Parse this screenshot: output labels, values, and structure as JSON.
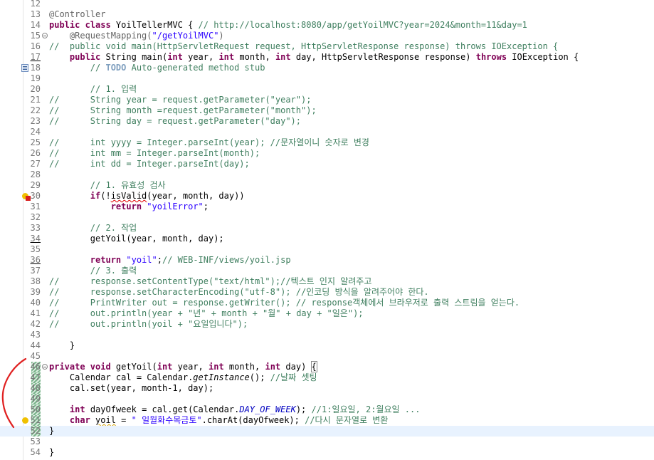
{
  "editor": {
    "lines": [
      {
        "n": "12",
        "segs": []
      },
      {
        "n": "13",
        "segs": [
          {
            "t": "@Controller",
            "c": "ann"
          }
        ]
      },
      {
        "n": "14",
        "segs": [
          {
            "t": "public class",
            "c": "kw"
          },
          {
            "t": " YoilTellerMVC { "
          },
          {
            "t": "// http://localhost:8080/app/getYoilMVC?year=2024&month=11&day=1",
            "c": "cm"
          }
        ]
      },
      {
        "n": "15",
        "fold": true,
        "segs": [
          {
            "t": "    "
          },
          {
            "t": "@RequestMapping(",
            "c": "ann"
          },
          {
            "t": "\"/getYoilMVC\"",
            "c": "str"
          },
          {
            "t": ")",
            "c": "ann"
          }
        ]
      },
      {
        "n": "16",
        "segs": [
          {
            "t": "//  public void main(HttpServletRequest request, HttpServletResponse response) throws IOException {",
            "c": "cm"
          }
        ]
      },
      {
        "n": "17",
        "ul": true,
        "segs": [
          {
            "t": "    "
          },
          {
            "t": "public",
            "c": "kw"
          },
          {
            "t": " String main("
          },
          {
            "t": "int",
            "c": "kw"
          },
          {
            "t": " year, "
          },
          {
            "t": "int",
            "c": "kw"
          },
          {
            "t": " month, "
          },
          {
            "t": "int",
            "c": "kw"
          },
          {
            "t": " day, HttpServletResponse response) "
          },
          {
            "t": "throws",
            "c": "kw"
          },
          {
            "t": " IOException {"
          }
        ]
      },
      {
        "n": "18",
        "marker": "task",
        "segs": [
          {
            "t": "        "
          },
          {
            "t": "// ",
            "c": "cm"
          },
          {
            "t": "TODO",
            "c": "todo"
          },
          {
            "t": " Auto-generated method stub",
            "c": "cm"
          }
        ]
      },
      {
        "n": "19",
        "segs": []
      },
      {
        "n": "20",
        "segs": [
          {
            "t": "        "
          },
          {
            "t": "// 1. 입력",
            "c": "cm"
          }
        ]
      },
      {
        "n": "21",
        "segs": [
          {
            "t": "//      String year = request.getParameter(\"year\");",
            "c": "cm"
          }
        ]
      },
      {
        "n": "22",
        "segs": [
          {
            "t": "//      String month =request.getParameter(\"month\");",
            "c": "cm"
          }
        ]
      },
      {
        "n": "23",
        "segs": [
          {
            "t": "//      String day = request.getParameter(\"day\");",
            "c": "cm"
          }
        ]
      },
      {
        "n": "24",
        "segs": []
      },
      {
        "n": "25",
        "segs": [
          {
            "t": "//      int yyyy = Integer.parseInt(year); //문자열이니 숫자로 변경",
            "c": "cm"
          }
        ]
      },
      {
        "n": "26",
        "segs": [
          {
            "t": "//      int mm = Integer.parseInt(month);",
            "c": "cm"
          }
        ]
      },
      {
        "n": "27",
        "segs": [
          {
            "t": "//      int dd = Integer.parseInt(day);",
            "c": "cm"
          }
        ]
      },
      {
        "n": "28",
        "segs": []
      },
      {
        "n": "29",
        "segs": [
          {
            "t": "        "
          },
          {
            "t": "// 1. 유효성 검사",
            "c": "cm"
          }
        ]
      },
      {
        "n": "30",
        "marker": "error",
        "segs": [
          {
            "t": "        "
          },
          {
            "t": "if",
            "c": "kw"
          },
          {
            "t": "(!"
          },
          {
            "t": "isValid",
            "c": "err"
          },
          {
            "t": "(year, month, day))"
          }
        ]
      },
      {
        "n": "31",
        "segs": [
          {
            "t": "            "
          },
          {
            "t": "return",
            "c": "kw"
          },
          {
            "t": " "
          },
          {
            "t": "\"yoilError\"",
            "c": "str"
          },
          {
            "t": ";"
          }
        ]
      },
      {
        "n": "32",
        "segs": []
      },
      {
        "n": "33",
        "segs": [
          {
            "t": "        "
          },
          {
            "t": "// 2. 작업",
            "c": "cm"
          }
        ]
      },
      {
        "n": "34",
        "ul": true,
        "segs": [
          {
            "t": "        getYoil(year, month, day);"
          }
        ]
      },
      {
        "n": "35",
        "segs": []
      },
      {
        "n": "36",
        "ul": true,
        "segs": [
          {
            "t": "        "
          },
          {
            "t": "return",
            "c": "kw"
          },
          {
            "t": " "
          },
          {
            "t": "\"yoil\"",
            "c": "str"
          },
          {
            "t": ";"
          },
          {
            "t": "// WEB-INF/views/yoil.jsp",
            "c": "cm"
          }
        ]
      },
      {
        "n": "37",
        "segs": [
          {
            "t": "        "
          },
          {
            "t": "// 3. 출력",
            "c": "cm"
          }
        ]
      },
      {
        "n": "38",
        "segs": [
          {
            "t": "//      response.setContentType(\"text/html\");//텍스트 인지 알려주고",
            "c": "cm"
          }
        ]
      },
      {
        "n": "39",
        "segs": [
          {
            "t": "//      response.setCharacterEncoding(\"utf-8\"); //인코딩 방식을 알려주어야 한다.",
            "c": "cm"
          }
        ]
      },
      {
        "n": "40",
        "segs": [
          {
            "t": "//      PrintWriter out = response.getWriter(); // response객체에서 브라우저로 출력 스트림을 얻는다.",
            "c": "cm"
          }
        ]
      },
      {
        "n": "41",
        "segs": [
          {
            "t": "//      out.println(year + \"년\" + month + \"월\" + day + \"일은\");",
            "c": "cm"
          }
        ]
      },
      {
        "n": "42",
        "segs": [
          {
            "t": "//      out.println(yoil + \"요일입니다\");",
            "c": "cm"
          }
        ]
      },
      {
        "n": "43",
        "segs": []
      },
      {
        "n": "44",
        "segs": [
          {
            "t": "    }"
          }
        ]
      },
      {
        "n": "45",
        "segs": []
      },
      {
        "n": "46",
        "fold": true,
        "change": true,
        "segs": [
          {
            "t": "private void",
            "c": "kw"
          },
          {
            "t": " getYoil("
          },
          {
            "t": "int",
            "c": "kw"
          },
          {
            "t": " year, "
          },
          {
            "t": "int",
            "c": "kw"
          },
          {
            "t": " month, "
          },
          {
            "t": "int",
            "c": "kw"
          },
          {
            "t": " day) "
          },
          {
            "t": "{",
            "c": "br"
          }
        ]
      },
      {
        "n": "47",
        "change": true,
        "segs": [
          {
            "t": "    Calendar cal = Calendar."
          },
          {
            "t": "getInstance",
            "c": "it"
          },
          {
            "t": "(); "
          },
          {
            "t": "//날짜 셋팅",
            "c": "cm"
          }
        ]
      },
      {
        "n": "48",
        "change": true,
        "segs": [
          {
            "t": "    cal.set(year, month-1, day);"
          }
        ]
      },
      {
        "n": "49",
        "change": true,
        "segs": []
      },
      {
        "n": "50",
        "change": true,
        "segs": [
          {
            "t": "    "
          },
          {
            "t": "int",
            "c": "kw"
          },
          {
            "t": " dayOfweek = cal.get(Calendar."
          },
          {
            "t": "DAY_OF_WEEK",
            "c": "static"
          },
          {
            "t": "); "
          },
          {
            "t": "//1:일요일, 2:월요일 ...",
            "c": "cm"
          }
        ]
      },
      {
        "n": "51",
        "marker": "warn",
        "change": true,
        "segs": [
          {
            "t": "    "
          },
          {
            "t": "char",
            "c": "kw"
          },
          {
            "t": " "
          },
          {
            "t": "yoil",
            "c": "warn"
          },
          {
            "t": " = "
          },
          {
            "t": "\" 일월화수목금토\"",
            "c": "str"
          },
          {
            "t": ".charAt(dayOfweek); "
          },
          {
            "t": "//다시 문자열로 변환",
            "c": "cm"
          }
        ]
      },
      {
        "n": "52",
        "change": true,
        "hl": true,
        "segs": [
          {
            "t": "}"
          }
        ]
      },
      {
        "n": "53",
        "segs": []
      },
      {
        "n": "54",
        "segs": [
          {
            "t": "}"
          }
        ]
      }
    ]
  },
  "icons": {
    "task_marker": "task-icon",
    "error_marker": "error-icon",
    "warning_marker": "warning-icon",
    "fold_toggle": "collapse-icon"
  },
  "colors": {
    "keyword": "#7f0055",
    "string": "#2a00ff",
    "comment": "#3f7f5f",
    "annotation": "#646464",
    "static_field": "#0000c0",
    "current_line": "#e8f2fe",
    "annotation_ink": "#e02020"
  }
}
